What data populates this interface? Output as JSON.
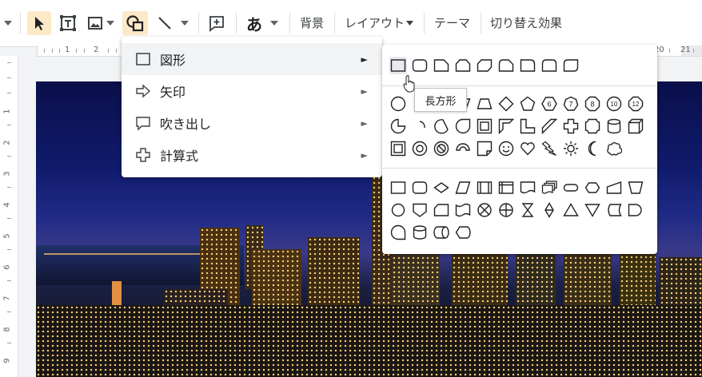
{
  "toolbar": {
    "background_label": "背景",
    "layout_label": "レイアウト",
    "theme_label": "テーマ",
    "transition_label": "切り替え効果",
    "text_style_glyph": "あ",
    "accent_color": "#fbe9c7"
  },
  "ruler": {
    "h_labels": [
      "1",
      "2",
      "20",
      "21"
    ],
    "v_labels": [
      "1",
      "2",
      "3",
      "4",
      "5",
      "6",
      "7",
      "8",
      "9"
    ]
  },
  "insert_menu": {
    "items": [
      {
        "label": "図形",
        "icon": "square-outline-icon",
        "highlighted": true
      },
      {
        "label": "矢印",
        "icon": "arrow-right-outline-icon"
      },
      {
        "label": "吹き出し",
        "icon": "speech-bubble-icon"
      },
      {
        "label": "計算式",
        "icon": "plus-cross-icon"
      }
    ],
    "submenu_arrow": "►"
  },
  "shapes_panel": {
    "tooltip": "長方形",
    "octagon_labels": [
      "6",
      "7",
      "8",
      "10",
      "12"
    ]
  }
}
